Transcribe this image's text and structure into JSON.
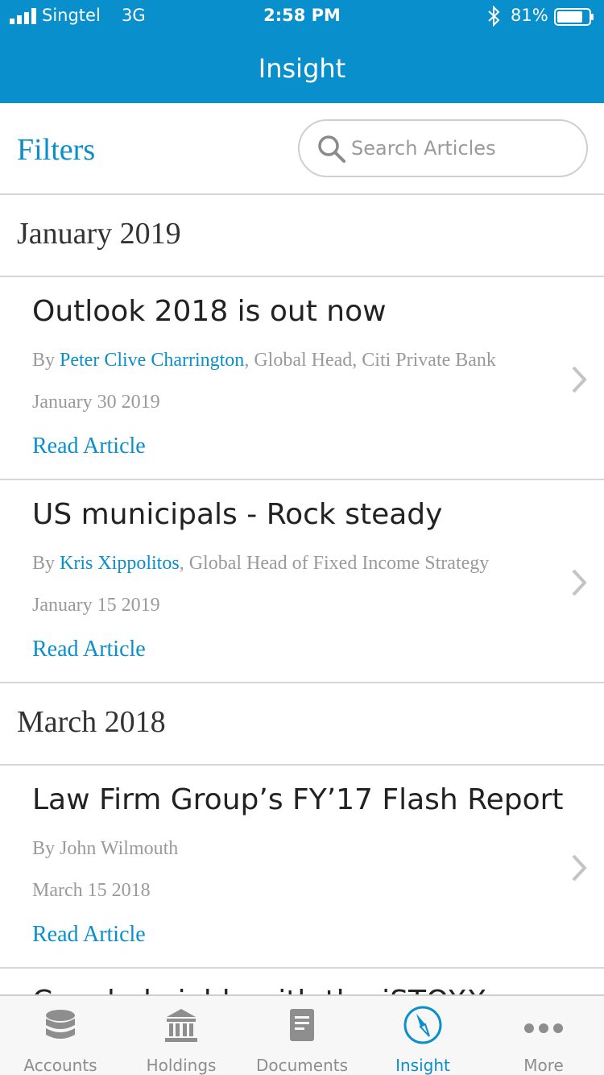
{
  "status_bar": {
    "carrier": "Singtel",
    "network": "3G",
    "time": "2:58 PM",
    "battery": "81%",
    "battery_level": 0.81
  },
  "nav": {
    "title": "Insight"
  },
  "filter_bar": {
    "filters_label": "Filters",
    "search_placeholder": "Search Articles"
  },
  "sections": [
    {
      "title": "January 2019",
      "articles": [
        {
          "title": "Outlook 2018 is out now",
          "by": "By ",
          "author": "Peter Clive Charrington",
          "role": ", Global Head, Citi Private Bank",
          "date": "January 30 2019",
          "link": "Read Article"
        },
        {
          "title": "US municipals - Rock steady",
          "by": "By ",
          "author": "Kris Xippolitos",
          "role": ", Global Head of Fixed Income Strategy",
          "date": "January 15 2019",
          "link": "Read Article"
        }
      ]
    },
    {
      "title": "March 2018",
      "articles": [
        {
          "title": "Law Firm Group’s FY’17 Flash Report",
          "by": "By John Wilmouth",
          "date": "March 15 2018",
          "link": "Read Article"
        },
        {
          "title": "Coupled yields with the iSTOXX"
        }
      ]
    }
  ],
  "tab_bar": {
    "active": "Insight",
    "active_color": "#0a8fcd",
    "inactive_color": "#8e8e8e",
    "tabs": [
      {
        "label": "Accounts",
        "icon": "database-icon"
      },
      {
        "label": "Holdings",
        "icon": "bank-icon"
      },
      {
        "label": "Documents",
        "icon": "document-icon"
      },
      {
        "label": "Insight",
        "icon": "compass-icon"
      },
      {
        "label": "More",
        "icon": "more-dots-icon"
      }
    ]
  },
  "colors": {
    "accent": "#0a8fcd",
    "divider": "#d6d6d6",
    "muted_text": "#9a9a9a"
  }
}
